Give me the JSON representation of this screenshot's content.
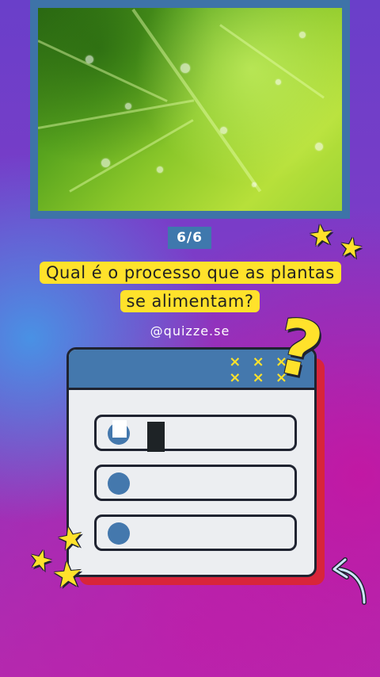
{
  "counter": "6/6",
  "question": "Qual é o processo que as plantas se alimentam?",
  "handle": "@quizze.se",
  "header_marks": "× × ×\n× × ×",
  "options": [
    {
      "label": ""
    },
    {
      "label": ""
    },
    {
      "label": ""
    }
  ],
  "icons": {
    "star": "★",
    "question": "?"
  },
  "colors": {
    "accent_yellow": "#ffe22b",
    "frame_blue": "#3e73a8",
    "card_red": "#d8253a"
  }
}
